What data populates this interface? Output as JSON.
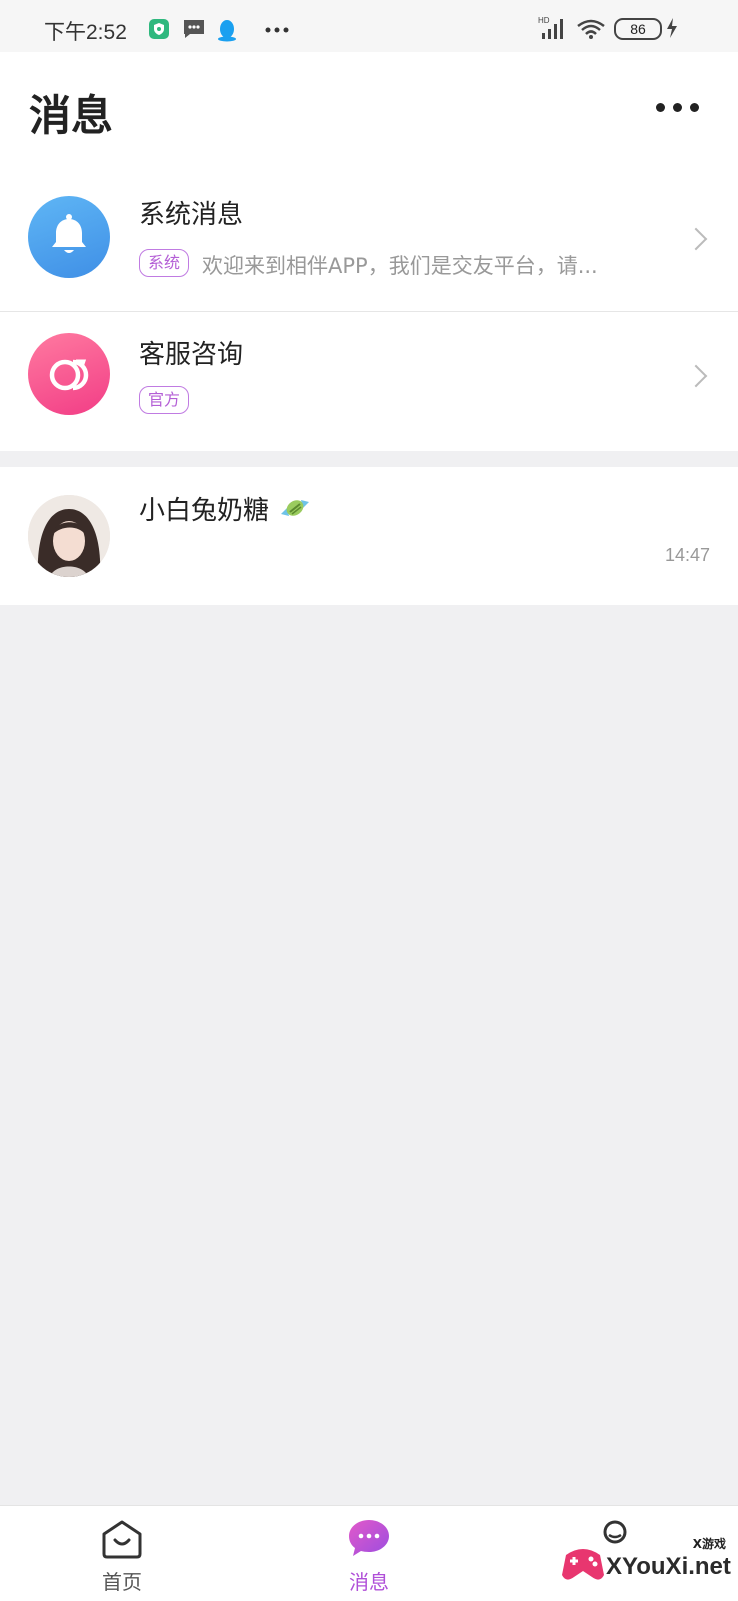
{
  "status_bar": {
    "time": "下午2:52",
    "battery": "86",
    "signal_label": "HD"
  },
  "header": {
    "title": "消息"
  },
  "messages": {
    "system": {
      "title": "系统消息",
      "tag": "系统",
      "preview": "欢迎来到相伴APP，我们是交友平台，请..."
    },
    "service": {
      "title": "客服咨询",
      "tag": "官方"
    },
    "chat": {
      "name": "小白兔奶糖",
      "time": "14:47"
    }
  },
  "tabbar": {
    "home_label": "首页",
    "messages_label": "消息"
  },
  "watermark": {
    "brand": "XYouXi.net",
    "sub": "X游戏"
  },
  "colors": {
    "accent": "#b04fd8",
    "system_blue": "#4aa3ef",
    "service_pink": "#f2568f"
  }
}
